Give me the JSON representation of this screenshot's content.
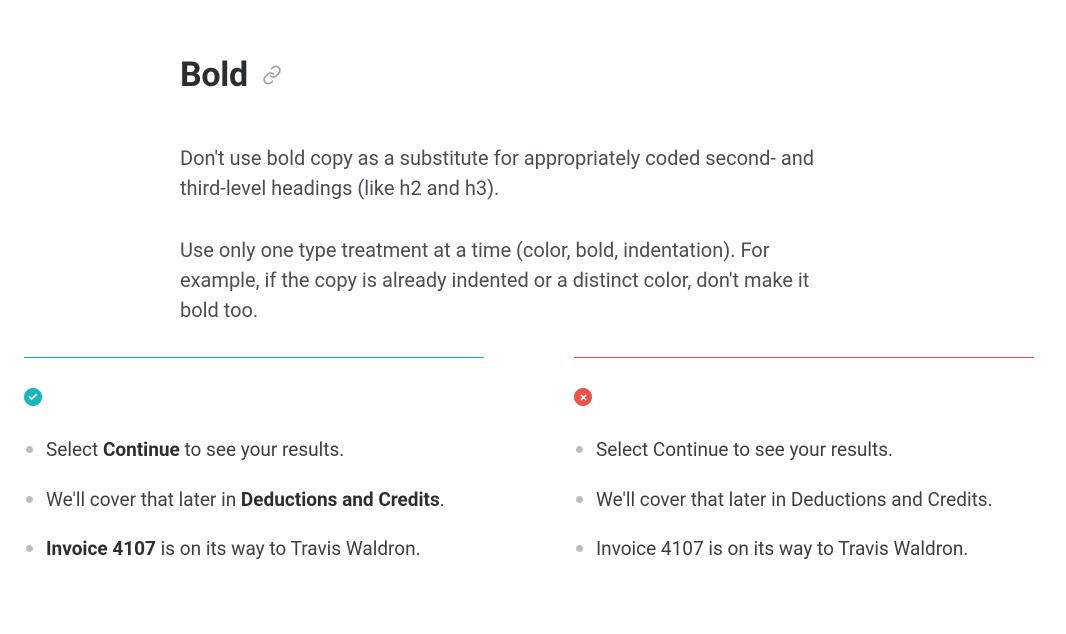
{
  "heading": "Bold",
  "paragraphs": [
    "Don't use bold copy as a substitute for appropriately coded second- and third-level headings (like h2 and h3).",
    "Use only one type treatment at a time (color, bold, indentation). For example, if the copy is already indented or a distinct color, don't make it bold too."
  ],
  "good": {
    "items": [
      {
        "pre": "Select ",
        "bold": "Continue",
        "post": " to see your results."
      },
      {
        "pre": "We'll cover that later in ",
        "bold": "Deductions and Credits",
        "post": "."
      },
      {
        "pre": "",
        "bold": "Invoice 4107",
        "post": " is on its way to Travis Waldron."
      }
    ]
  },
  "bad": {
    "items": [
      {
        "text": "Select Continue to see your results."
      },
      {
        "text": "We'll cover that later in Deductions and Credits."
      },
      {
        "text": "Invoice 4107 is on its way to Travis Waldron."
      }
    ]
  },
  "colors": {
    "good": "#15b7b9",
    "bad": "#e85547"
  }
}
